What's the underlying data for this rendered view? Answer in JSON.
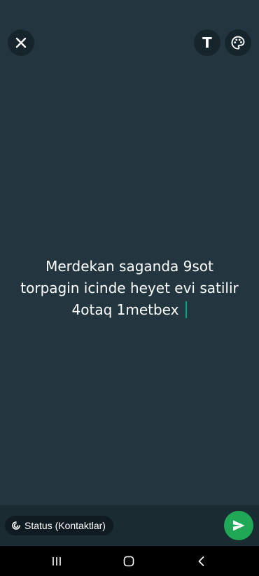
{
  "toolbar": {
    "close_icon": "close-icon",
    "text_tool_label": "T",
    "palette_icon": "palette-icon"
  },
  "status": {
    "lines": [
      "Merdekan saganda 9sot",
      "torpagin icinde heyet evi satilir",
      "4otaq 1metbex"
    ],
    "background_color": "#233640",
    "caret_color": "#00a884"
  },
  "footer": {
    "audience_icon": "status-privacy-icon",
    "audience_label": "Status (Kontaktlar)",
    "send_icon": "send-icon",
    "send_color": "#1fa855"
  },
  "navigation": {
    "recent_icon": "recent-apps-icon",
    "home_icon": "home-icon",
    "back_icon": "back-icon"
  }
}
